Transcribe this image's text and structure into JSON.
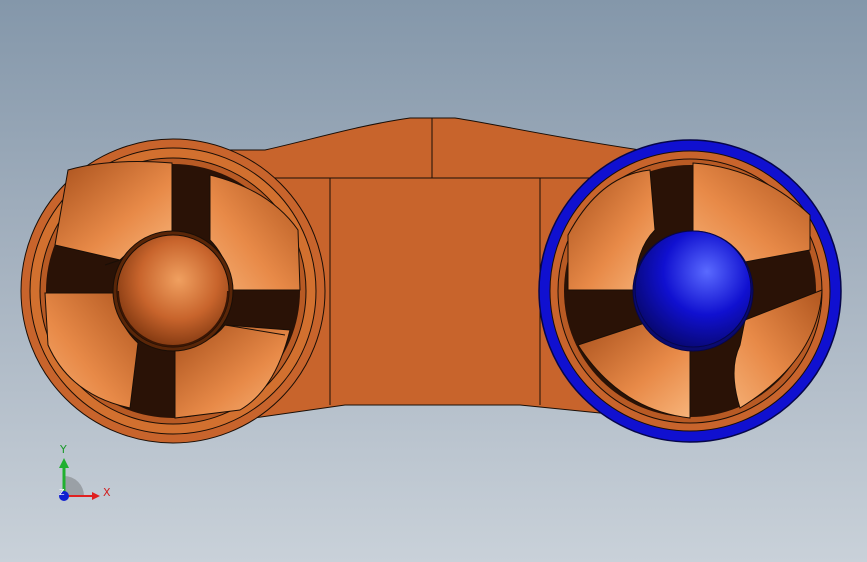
{
  "scene": {
    "background": {
      "top": "#8497aa",
      "bottom": "#c9d1d9"
    },
    "colors": {
      "body": "#c8642c",
      "body_edge": "#1a0e06",
      "blade_light": "#f2a868",
      "blade_dark": "#a8501c",
      "hub": "#d27833",
      "selected": "#1010d0",
      "selected_light": "#4a5aff"
    },
    "selected_component": "right-fan"
  },
  "triad": {
    "x_label": "X",
    "y_label": "Y",
    "z_label": "Z",
    "x_color": "#e02020",
    "y_color": "#20b030",
    "z_color": "#1020d0"
  }
}
